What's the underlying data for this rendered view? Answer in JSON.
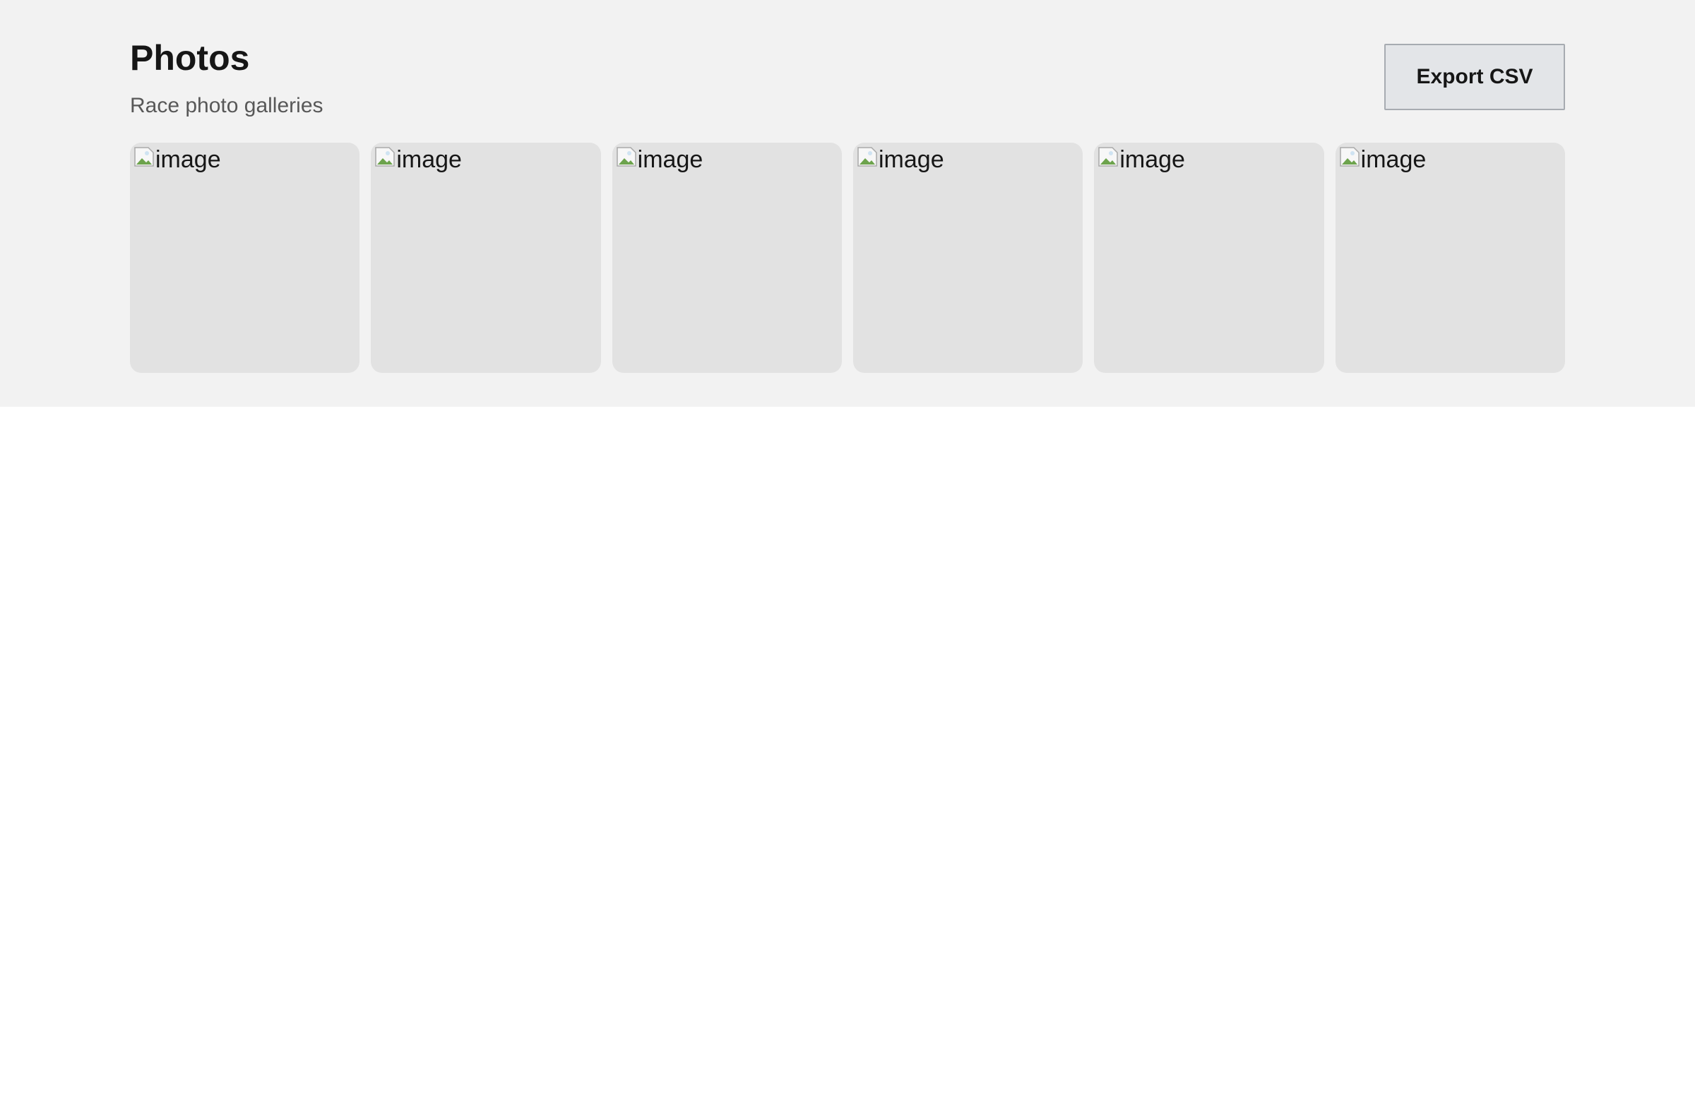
{
  "header": {
    "title": "Photos",
    "subtitle": "Race photo galleries",
    "export_label": "Export CSV"
  },
  "gallery": {
    "broken_image_icon": "broken-image-icon",
    "tiles": [
      {
        "alt": "image"
      },
      {
        "alt": "image"
      },
      {
        "alt": "image"
      },
      {
        "alt": "image"
      },
      {
        "alt": "image"
      },
      {
        "alt": "image"
      }
    ]
  },
  "colors": {
    "panel_background": "#f2f2f2",
    "tile_background": "#e2e2e2",
    "button_background": "#e3e5e8",
    "button_border": "#a7abb1",
    "title_text": "#161616",
    "subtitle_text": "#585858"
  }
}
